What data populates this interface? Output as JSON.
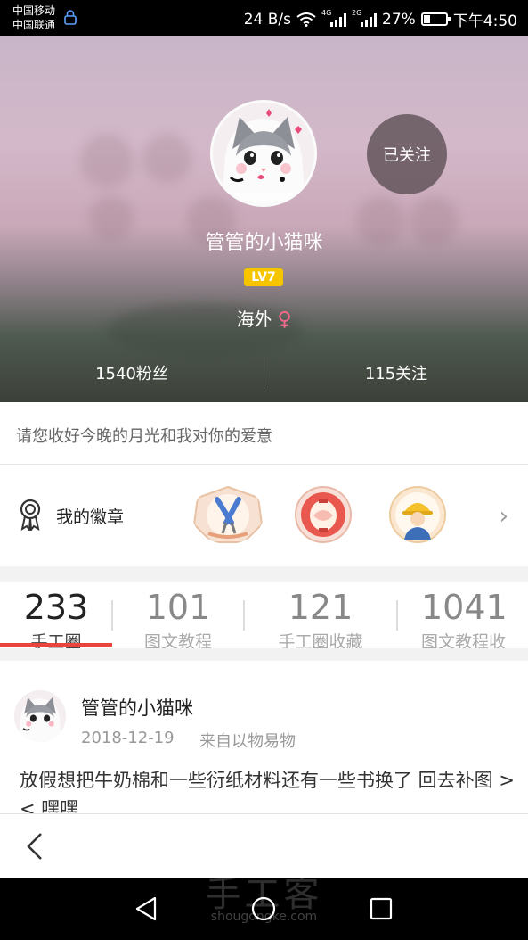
{
  "status_bar": {
    "carrier_1": "中国移动",
    "carrier_2": "中国联通",
    "net_speed": "24 B/s",
    "signal_1_gen": "4G",
    "signal_2_gen": "2G",
    "battery": "27%",
    "battery_level": 0.27,
    "time": "下午4:50"
  },
  "profile": {
    "follow_button": "已关注",
    "username": "管管的小猫咪",
    "level": "LV7",
    "location": "海外",
    "gender_icon": "female-icon",
    "fans": "1540粉丝",
    "following": "115关注",
    "bio": "请您收好今晚的月光和我对你的爱意"
  },
  "badges": {
    "label": "我的徽章",
    "icon": "medal-icon",
    "items": [
      "pliers-badge",
      "lantern-badge",
      "worker-badge"
    ],
    "more_icon": "chevron-right-icon"
  },
  "tabs": [
    {
      "count": "233",
      "label": "手工圈",
      "active": true
    },
    {
      "count": "101",
      "label": "图文教程",
      "active": false
    },
    {
      "count": "121",
      "label": "手工圈收藏",
      "active": false
    },
    {
      "count": "1041",
      "label": "图文教程收",
      "active": false
    }
  ],
  "post": {
    "author": "管管的小猫咪",
    "date": "2018-12-19",
    "source": "来自以物易物",
    "text": "放假想把牛奶棉和一些衍纸材料还有一些书换了 回去补图 ><  嘿嘿"
  },
  "watermark": {
    "title": "手工客",
    "site": "shougongke.com"
  },
  "colors": {
    "accent": "#e8453c",
    "level_badge": "#f7c400",
    "female": "#f06a8a"
  }
}
